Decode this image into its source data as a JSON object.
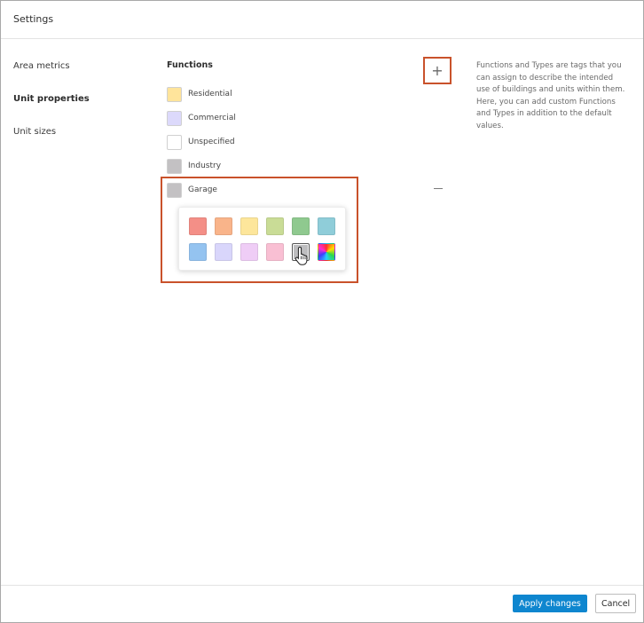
{
  "dialog": {
    "title": "Settings"
  },
  "nav": {
    "items": [
      {
        "label": "Area metrics",
        "active": false
      },
      {
        "label": "Unit properties",
        "active": true
      },
      {
        "label": "Unit sizes",
        "active": false
      }
    ]
  },
  "functions": {
    "title": "Functions",
    "add_icon": "plus-icon",
    "remove_icon": "minus-icon",
    "items": [
      {
        "label": "Residential",
        "color": "#ffe49b"
      },
      {
        "label": "Commercial",
        "color": "#dcd9fb"
      },
      {
        "label": "Unspecified",
        "color": "#ffffff"
      },
      {
        "label": "Industry",
        "color": "#c3c1c3"
      },
      {
        "label": "Garage",
        "color": "#c3c1c3"
      }
    ]
  },
  "color_picker": {
    "swatches": [
      "#f48f87",
      "#f9b48a",
      "#fde69b",
      "#c9dc96",
      "#8fc98f",
      "#8fcdd9",
      "#94c3f0",
      "#d9d6fb",
      "#efcdf6",
      "#f9bfd3",
      "#bdbdbf",
      "rainbow"
    ],
    "selected_index": 10
  },
  "help": {
    "text": "Functions and Types are tags that you can assign to describe the intended use of buildings and units within them. Here, you can add custom Functions and Types in addition to the default values."
  },
  "footer": {
    "apply_label": "Apply changes",
    "cancel_label": "Cancel"
  },
  "colors": {
    "primary": "#0e86cf",
    "highlight": "#c9522b"
  }
}
